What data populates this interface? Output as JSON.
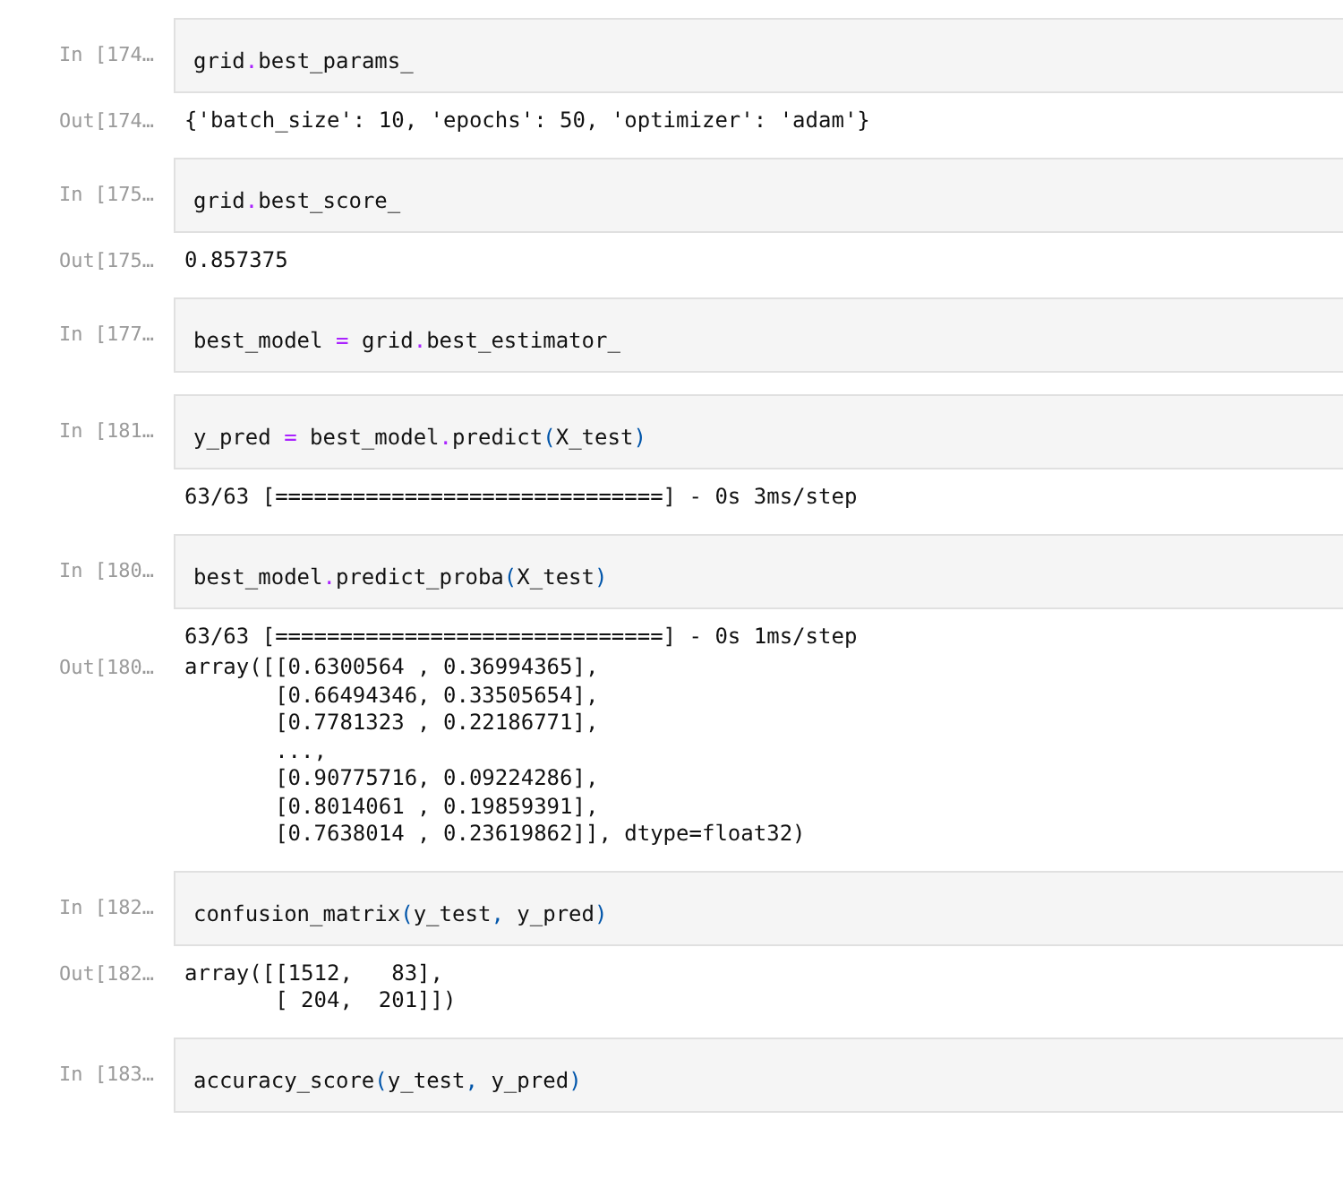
{
  "cells": [
    {
      "in_prompt": "In [174…",
      "code": [
        {
          "text": "grid",
          "kind": "name"
        },
        {
          "text": ".",
          "kind": "op"
        },
        {
          "text": "best_params_",
          "kind": "name"
        }
      ],
      "outputs": [
        {
          "kind": "result",
          "prompt": "Out[174…",
          "lines": [
            "{'batch_size': 10, 'epochs': 50, 'optimizer': 'adam'}"
          ]
        }
      ]
    },
    {
      "in_prompt": "In [175…",
      "code": [
        {
          "text": "grid",
          "kind": "name"
        },
        {
          "text": ".",
          "kind": "op"
        },
        {
          "text": "best_score_",
          "kind": "name"
        }
      ],
      "outputs": [
        {
          "kind": "result",
          "prompt": "Out[175…",
          "lines": [
            "0.857375"
          ]
        }
      ]
    },
    {
      "in_prompt": "In [177…",
      "code": [
        {
          "text": "best_model ",
          "kind": "name"
        },
        {
          "text": "=",
          "kind": "op"
        },
        {
          "text": " grid",
          "kind": "name"
        },
        {
          "text": ".",
          "kind": "op"
        },
        {
          "text": "best_estimator_",
          "kind": "name"
        }
      ]
    },
    {
      "in_prompt": "In [181…",
      "code": [
        {
          "text": "y_pred ",
          "kind": "name"
        },
        {
          "text": "=",
          "kind": "op"
        },
        {
          "text": " best_model",
          "kind": "name"
        },
        {
          "text": ".",
          "kind": "op"
        },
        {
          "text": "predict",
          "kind": "name"
        },
        {
          "text": "(",
          "kind": "paren"
        },
        {
          "text": "X_test",
          "kind": "name"
        },
        {
          "text": ")",
          "kind": "paren"
        }
      ],
      "outputs": [
        {
          "kind": "stream",
          "lines": [
            "63/63 [==============================] - 0s 3ms/step"
          ]
        }
      ]
    },
    {
      "in_prompt": "In [180…",
      "code": [
        {
          "text": "best_model",
          "kind": "name"
        },
        {
          "text": ".",
          "kind": "op"
        },
        {
          "text": "predict_proba",
          "kind": "name"
        },
        {
          "text": "(",
          "kind": "paren"
        },
        {
          "text": "X_test",
          "kind": "name"
        },
        {
          "text": ")",
          "kind": "paren"
        }
      ],
      "outputs": [
        {
          "kind": "stream",
          "lines": [
            "63/63 [==============================] - 0s 1ms/step"
          ]
        },
        {
          "kind": "result",
          "prompt": "Out[180…",
          "lines": [
            "array([[0.6300564 , 0.36994365],",
            "       [0.66494346, 0.33505654],",
            "       [0.7781323 , 0.22186771],",
            "       ...,",
            "       [0.90775716, 0.09224286],",
            "       [0.8014061 , 0.19859391],",
            "       [0.7638014 , 0.23619862]], dtype=float32)"
          ]
        }
      ]
    },
    {
      "in_prompt": "In [182…",
      "code": [
        {
          "text": "confusion_matrix",
          "kind": "name"
        },
        {
          "text": "(",
          "kind": "paren"
        },
        {
          "text": "y_test",
          "kind": "name"
        },
        {
          "text": ",",
          "kind": "paren"
        },
        {
          "text": " y_pred",
          "kind": "name"
        },
        {
          "text": ")",
          "kind": "paren"
        }
      ],
      "outputs": [
        {
          "kind": "result",
          "prompt": "Out[182…",
          "lines": [
            "array([[1512,   83],",
            "       [ 204,  201]])"
          ]
        }
      ]
    },
    {
      "in_prompt": "In [183…",
      "code": [
        {
          "text": "accuracy_score",
          "kind": "name"
        },
        {
          "text": "(",
          "kind": "paren"
        },
        {
          "text": "y_test",
          "kind": "name"
        },
        {
          "text": ",",
          "kind": "paren"
        },
        {
          "text": " y_pred",
          "kind": "name"
        },
        {
          "text": ")",
          "kind": "paren"
        }
      ]
    }
  ]
}
